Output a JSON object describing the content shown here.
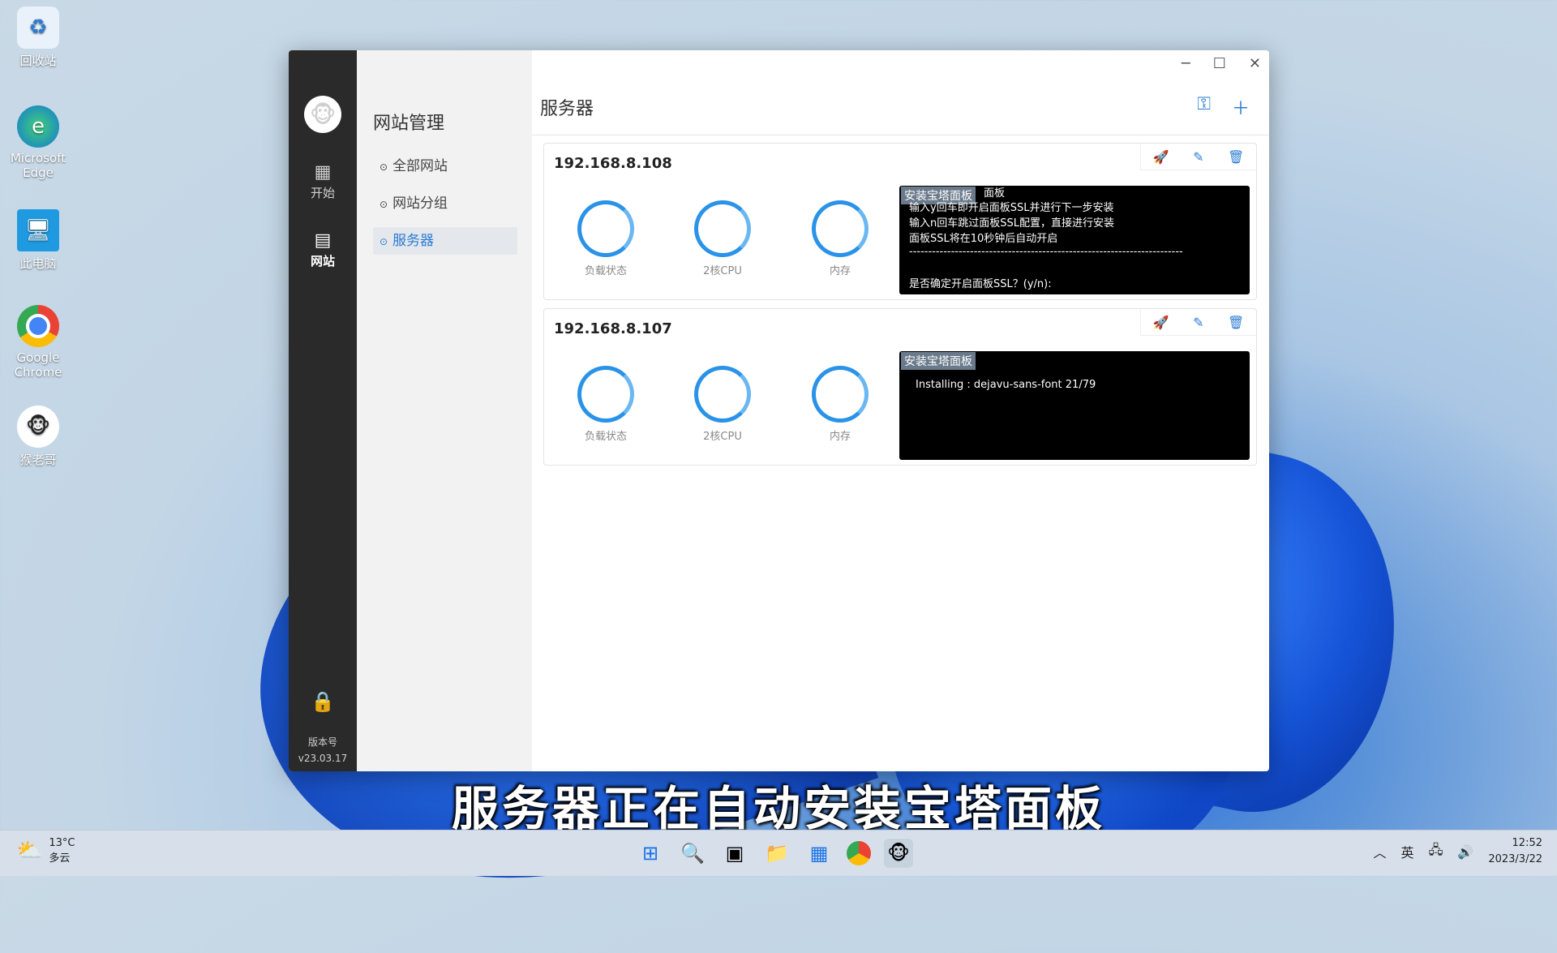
{
  "desktop": {
    "icons": [
      {
        "label": "回收站"
      },
      {
        "label": "Microsoft Edge"
      },
      {
        "label": "此电脑"
      },
      {
        "label": "Google Chrome"
      },
      {
        "label": "猴老哥"
      }
    ]
  },
  "app": {
    "rail": {
      "nav_start": "开始",
      "nav_site": "网站",
      "version_label": "版本号",
      "version": "v23.03.17"
    },
    "subnav": {
      "title": "网站管理",
      "items": [
        {
          "label": "全部网站"
        },
        {
          "label": "网站分组"
        },
        {
          "label": "服务器"
        }
      ]
    },
    "page_title": "服务器",
    "servers": [
      {
        "ip": "192.168.8.108",
        "gauges": [
          "负载状态",
          "2核CPU",
          "内存"
        ],
        "terminal_tag": "安装宝塔面板",
        "terminal_lines": [
          "面板",
          "输入y回车即开启面板SSL并进行下一步安装",
          "输入n回车跳过面板SSL配置，直接进行安装",
          "面板SSL将在10秒钟后自动开启",
          "------------------------------------------------------------------------",
          "是否确定开启面板SSL？(y/n):"
        ]
      },
      {
        "ip": "192.168.8.107",
        "gauges": [
          "负载状态",
          "2核CPU",
          "内存"
        ],
        "terminal_tag": "安装宝塔面板",
        "terminal_lines": [
          "Installing : dejavu-sans-font   21/79"
        ]
      }
    ]
  },
  "subtitle": "服务器正在自动安装宝塔面板",
  "taskbar": {
    "temp": "13°C",
    "weather": "多云",
    "ime": "英",
    "time": "12:52",
    "date": "2023/3/22"
  }
}
